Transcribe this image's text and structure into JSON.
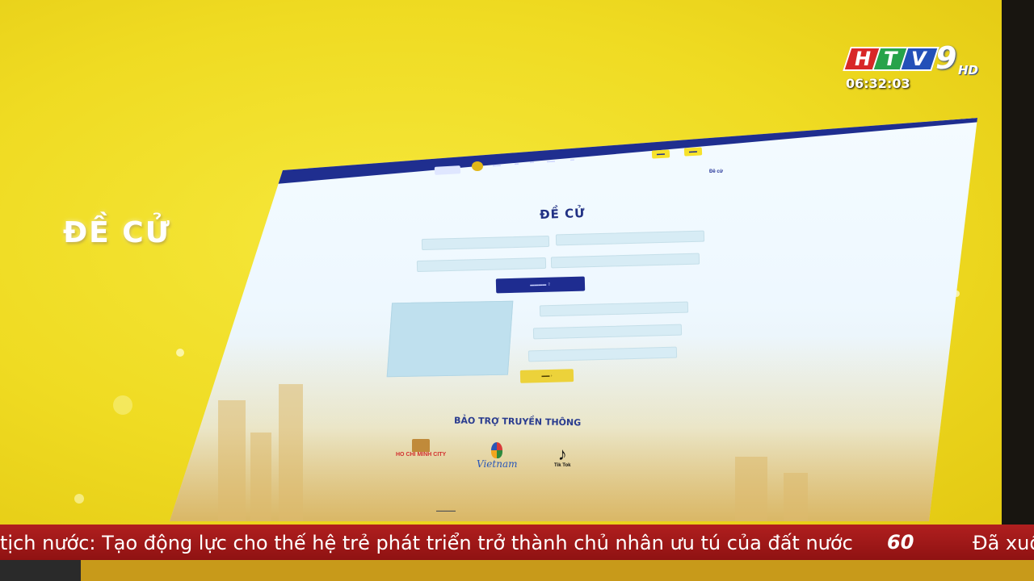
{
  "broadcast": {
    "channel_letters": [
      "H",
      "T",
      "V"
    ],
    "channel_number": "9",
    "channel_suffix": "HD",
    "clock": "06:32:03",
    "ticker_text": "tịch nước: Tạo động lực cho thế hệ trẻ phát triển trở thành chủ nhân ưu tú của đất nước",
    "ticker_mark": "60",
    "ticker_next": "Đã xuố",
    "colors": {
      "ticker_bg": "#a51a1a",
      "slide_bg": "#efdb22",
      "brand_blue": "#1f2e8f"
    }
  },
  "slide": {
    "title": "ĐỀ CỬ"
  },
  "website": {
    "breadcrumb": "Đề cử",
    "form": {
      "title": "ĐỀ CỬ",
      "sponsor_title": "BẢO TRỢ TRUYỀN THÔNG",
      "sponsors": [
        {
          "name": "HO CHI MINH CITY",
          "icon": "hcmc-logo-icon"
        },
        {
          "name": "Vietnam",
          "icon": "vietnam-tourism-logo-icon"
        },
        {
          "name": "Tik Tok",
          "icon": "tiktok-logo-icon"
        }
      ]
    }
  }
}
